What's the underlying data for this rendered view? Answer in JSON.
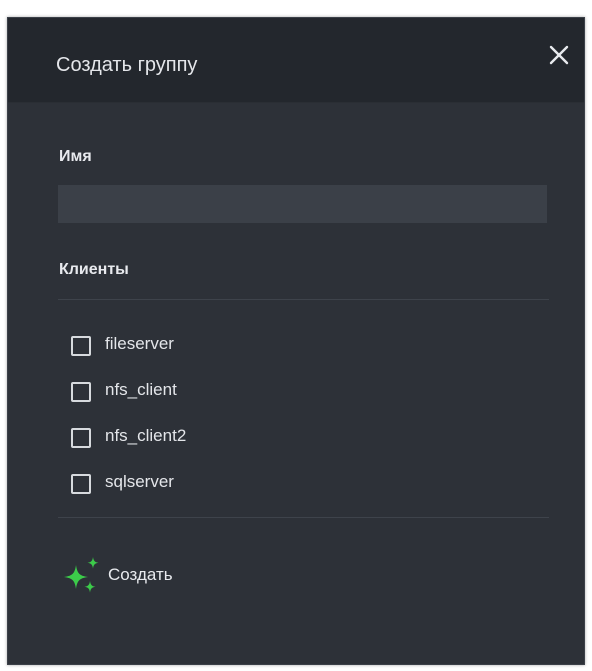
{
  "dialog": {
    "title": "Создать группу",
    "close_icon": "close-icon",
    "name_label": "Имя",
    "name_value": "",
    "clients_label": "Клиенты",
    "clients": [
      {
        "label": "fileserver",
        "checked": false
      },
      {
        "label": "nfs_client",
        "checked": false
      },
      {
        "label": "nfs_client2",
        "checked": false
      },
      {
        "label": "sqlserver",
        "checked": false
      }
    ],
    "create_label": "Создать",
    "create_icon": "sparkle-icon"
  },
  "colors": {
    "dialog_background": "#2d3138",
    "header_background": "#23272d",
    "input_background": "#3b4048",
    "text": "#e4e6ea",
    "accent_green": "#3ccb4a"
  }
}
